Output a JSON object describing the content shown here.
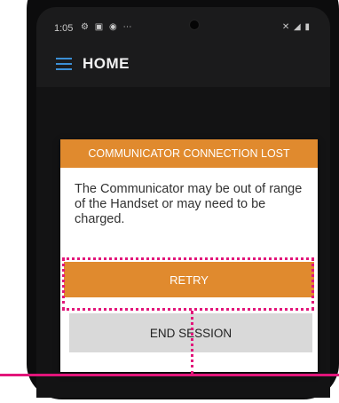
{
  "status_bar": {
    "time": "1:05",
    "left_icons": "⚙ ▣ ◉ ⋯",
    "right_icons": "✕ ◢ ▮"
  },
  "app_bar": {
    "menu_icon": "hamburger-menu-icon",
    "title": "HOME"
  },
  "dialog": {
    "header": "COMMUNICATOR CONNECTION LOST",
    "message": "The Communicator may be out of range of the Handset or may need to be charged.",
    "retry_label": "RETRY",
    "end_session_label": "END SESSION"
  },
  "colors": {
    "accent": "#e08a2e",
    "highlight": "#e2157a",
    "menu_icon": "#3b8fd6",
    "secondary_button": "#d9d9d9"
  }
}
